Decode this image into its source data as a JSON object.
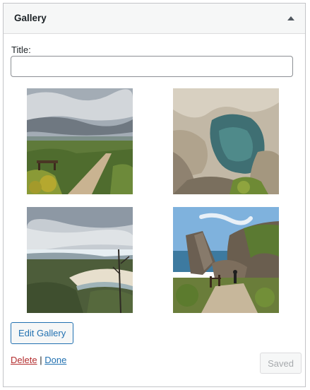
{
  "widget": {
    "title": "Gallery",
    "toggle_icon": "arrow-up-icon"
  },
  "form": {
    "title_label": "Title:",
    "title_value": ""
  },
  "gallery": {
    "images": [
      {
        "subject": "coastal heath path with wooden bench under cloudy sky"
      },
      {
        "subject": "limestone rock arch framing the sea"
      },
      {
        "subject": "curving beach bay viewed from vegetated headland"
      },
      {
        "subject": "large leaning rock on the coast with a person on a boardwalk"
      }
    ]
  },
  "buttons": {
    "edit_gallery": "Edit Gallery",
    "delete": "Delete",
    "separator": "|",
    "done": "Done",
    "saved": "Saved"
  },
  "colors": {
    "link": "#2271b1",
    "delete": "#b32d2e",
    "border": "#c3c4c7"
  }
}
